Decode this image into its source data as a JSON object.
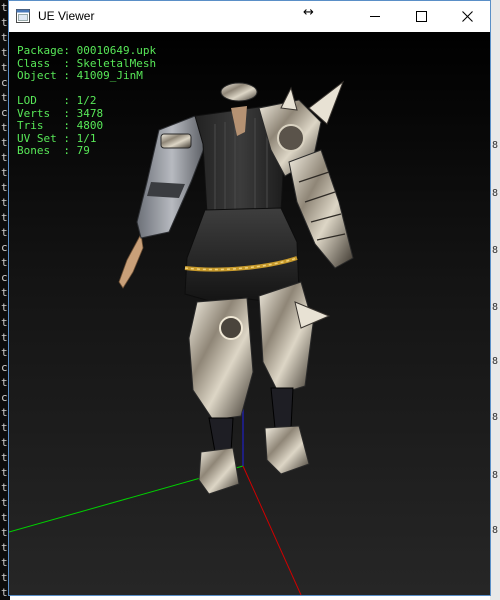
{
  "window": {
    "title": "UE Viewer"
  },
  "info": {
    "package_label": "Package: ",
    "package_value": "00010649.upk",
    "class_label": "Class  : ",
    "class_value": "SkeletalMesh",
    "object_label": "Object : ",
    "object_value": "41009_JinM",
    "lod_label": "LOD    : ",
    "lod_value": "1/2",
    "verts_label": "Verts  : ",
    "verts_value": "3478",
    "tris_label": "Tris   : ",
    "tris_value": "4800",
    "uvset_label": "UV Set : ",
    "uvset_value": "1/1",
    "bones_label": "Bones  : ",
    "bones_value": "79"
  },
  "axes": {
    "x_color": "#00d000",
    "y_color": "#d00000",
    "z_color": "#2020e0"
  },
  "colors": {
    "info_label": "#58e858",
    "info_value": "#ffffff",
    "window_border": "#5a8fc7"
  }
}
